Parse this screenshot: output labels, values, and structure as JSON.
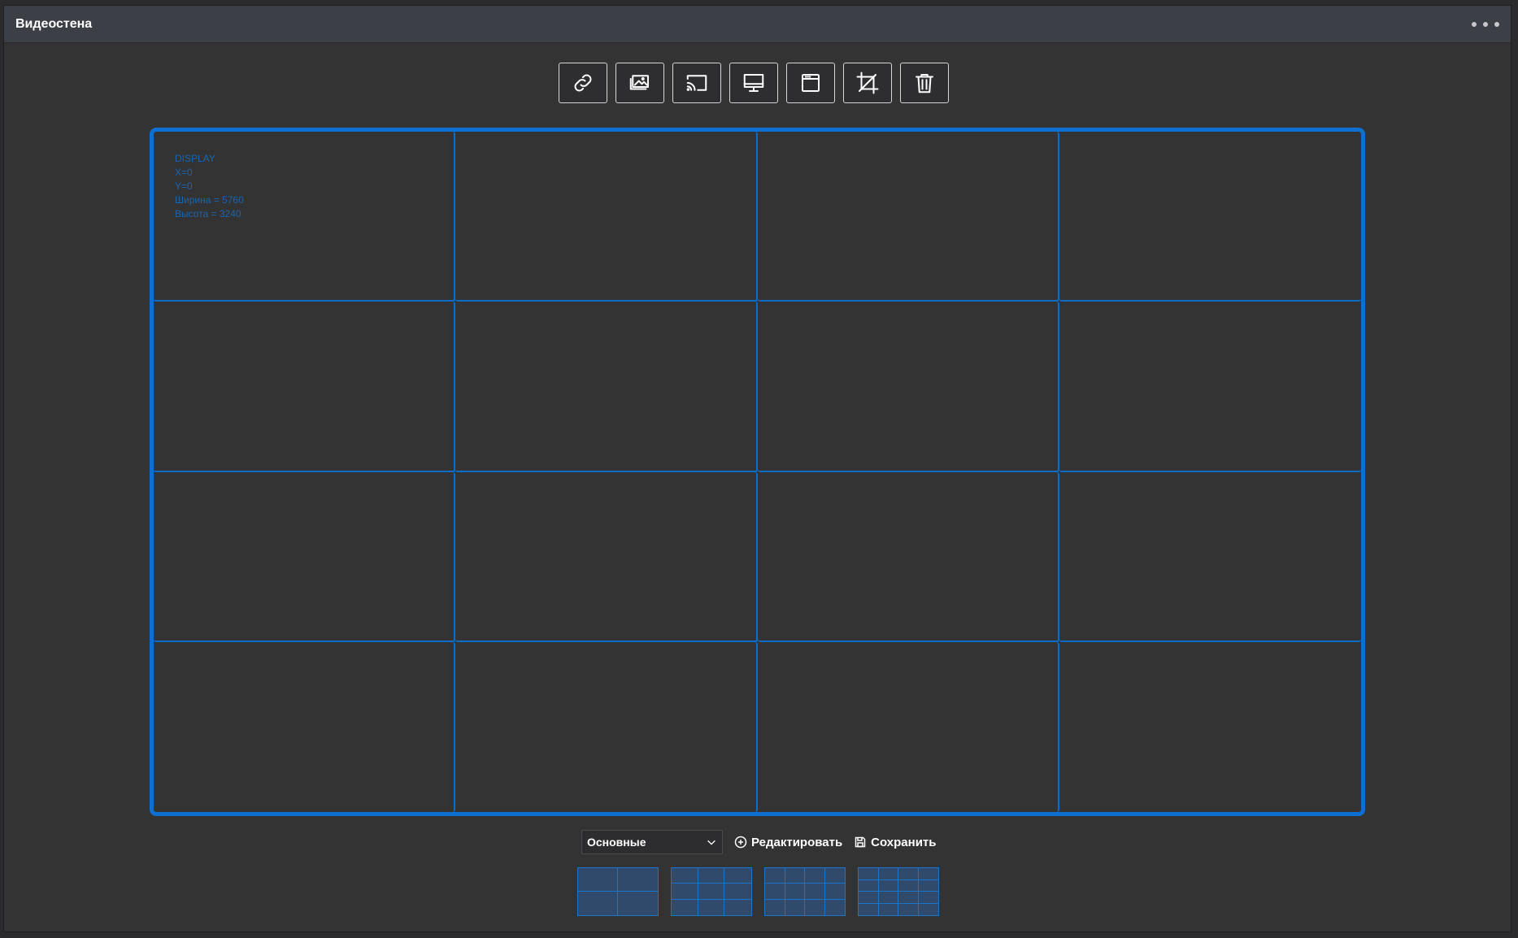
{
  "window": {
    "title": "Видеостена"
  },
  "toolbar": {
    "buttons": [
      {
        "icon": "link-icon"
      },
      {
        "icon": "images-icon"
      },
      {
        "icon": "cast-icon"
      },
      {
        "icon": "monitor-icon"
      },
      {
        "icon": "window-icon"
      },
      {
        "icon": "crop-icon"
      },
      {
        "icon": "trash-icon"
      }
    ]
  },
  "wall": {
    "rows": 4,
    "columns": 4,
    "display_info": {
      "name": "DISPLAY",
      "x": "X=0",
      "y": "Y=0",
      "width": "Ширина = 5760",
      "height": "Высота = 3240"
    }
  },
  "controls": {
    "preset_value": "Основные",
    "edit_label": "Редактировать",
    "save_label": "Сохранить"
  },
  "layouts": [
    {
      "name": "2x2",
      "columns": 2,
      "rows": 2
    },
    {
      "name": "3x3",
      "columns": 3,
      "rows": 3
    },
    {
      "name": "4x3",
      "columns": 4,
      "rows": 3
    },
    {
      "name": "4x4",
      "columns": 4,
      "rows": 4
    }
  ],
  "colors": {
    "accent": "#0d6fd1",
    "background": "#333334",
    "titlebar": "#3d3f46",
    "info_text": "#1a65ae"
  }
}
